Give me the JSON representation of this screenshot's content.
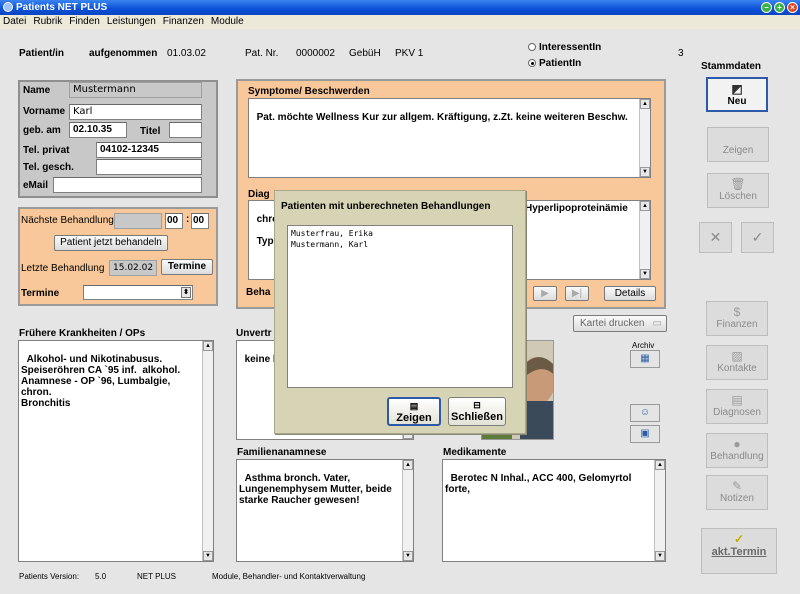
{
  "window": {
    "title": "Patients NET PLUS"
  },
  "menu": [
    "Datei",
    "Rubrik",
    "Finden",
    "Leistungen",
    "Finanzen",
    "Module"
  ],
  "header": {
    "patient_label": "Patient/in",
    "aufgenommen_label": "aufgenommen",
    "aufgenommen_date": "01.03.02",
    "pat_nr_label": "Pat. Nr.",
    "pat_nr": "0000002",
    "gebuehr_label": "GebüH",
    "kasse": "PKV 1",
    "radio_interessent": "InteressentIn",
    "radio_patient": "PatientIn",
    "count": "3"
  },
  "person": {
    "name_label": "Name",
    "name": "Mustermann",
    "vorname_label": "Vorname",
    "vorname": "Karl",
    "geb_label": "geb. am",
    "geb": "02.10.35",
    "titel_label": "Titel",
    "titel": "",
    "tel_privat_label": "Tel. privat",
    "tel_privat": "04102-12345",
    "tel_gesch_label": "Tel. gesch.",
    "tel_gesch": "",
    "email_label": "eMail",
    "email": ""
  },
  "termin_panel": {
    "naechste_label": "Nächste Behandlung",
    "naechste_date": "",
    "hh": "00",
    "colon": ":",
    "mm": "00",
    "jetzt_button": "Patient jetzt behandeln",
    "letzte_label": "Letzte Behandlung",
    "letzte_date": "15.02.02",
    "termine_button": "Termine",
    "termine_label": "Termine",
    "termine_select": ""
  },
  "symptome": {
    "label": "Symptome/ Beschwerden",
    "text": "Pat. möchte Wellness Kur zur allgem. Kräftigung, z.Zt. keine weiteren Beschw."
  },
  "diagnosen": {
    "label": "Diag",
    "text_line1": "chro",
    "text_line1_right": "Hyperlipoproteinämie",
    "text_line2": "Typ",
    "beh_label": "Beha",
    "details_button": "Details"
  },
  "kartei_button": "Kartei drucken",
  "archiv_label": "Archiv",
  "fruehere": {
    "label": "Frühere Krankheiten / OPs",
    "text": "Alkohol- und Nikotinabusus.\nSpeiseröhren CA `95 inf.  alkohol.\nAnamnese - OP `96, Lumbalgie, chron.\nBronchitis"
  },
  "unvertr": {
    "label": "Unvertr",
    "text": "keine b"
  },
  "familien": {
    "label": "Familienanamnese",
    "text": "Asthma bronch. Vater,\nLungenemphysem Mutter, beide\nstarke Raucher gewesen!"
  },
  "medikamente": {
    "label": "Medikamente",
    "text": "Berotec N Inhal., ACC 400, Gelomyrtol forte,"
  },
  "sidebar": {
    "title": "Stammdaten",
    "neu": "Neu",
    "zeigen": "Zeigen",
    "loeschen": "Löschen",
    "finanzen": "Finanzen",
    "kontakte": "Kontakte",
    "diagnosen": "Diagnosen",
    "behandlung": "Behandlung",
    "notizen": "Notizen",
    "akt_termin": "akt.Termin"
  },
  "footer": {
    "version_label": "Patients Version:",
    "version": "5.0",
    "edition": "NET PLUS",
    "desc": "Module, Behandler- und Kontaktverwaltung"
  },
  "dialog": {
    "title": "Patienten mit unberechneten Behandlungen",
    "items": [
      "Musterfrau, Erika",
      "Mustermann, Karl"
    ],
    "zeigen_button": "Zeigen",
    "schliessen_button": "Schließen"
  }
}
